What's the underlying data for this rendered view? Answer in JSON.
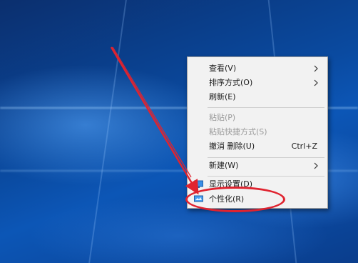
{
  "context_menu": {
    "items": [
      {
        "label": "查看(V)",
        "submenu": true,
        "disabled": false
      },
      {
        "label": "排序方式(O)",
        "submenu": true,
        "disabled": false
      },
      {
        "label": "刷新(E)",
        "submenu": false,
        "disabled": false
      },
      {
        "label": "粘贴(P)",
        "submenu": false,
        "disabled": true
      },
      {
        "label": "粘贴快捷方式(S)",
        "submenu": false,
        "disabled": true
      },
      {
        "label": "撤消 删除(U)",
        "shortcut": "Ctrl+Z",
        "submenu": false,
        "disabled": false
      },
      {
        "label": "新建(W)",
        "submenu": true,
        "disabled": false
      },
      {
        "label": "显示设置(D)",
        "icon": "display-settings-icon",
        "disabled": false
      },
      {
        "label": "个性化(R)",
        "icon": "personalize-icon",
        "disabled": false
      }
    ]
  },
  "annotation": {
    "color": "#e0232f",
    "highlighted_item": "个性化(R)"
  },
  "colors": {
    "menu_bg": "#f2f2f2",
    "desktop_blue": "#0a4aa0",
    "disabled_text": "#9a9a9a"
  }
}
